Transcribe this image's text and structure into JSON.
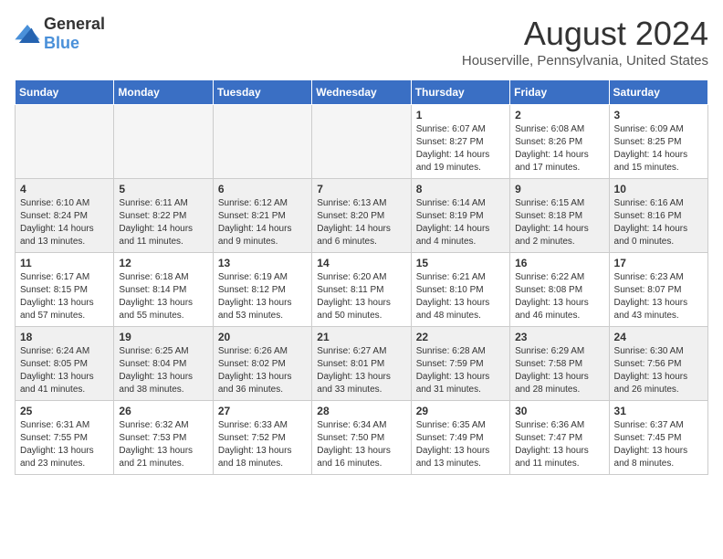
{
  "header": {
    "logo_general": "General",
    "logo_blue": "Blue",
    "month_title": "August 2024",
    "location": "Houserville, Pennsylvania, United States"
  },
  "weekdays": [
    "Sunday",
    "Monday",
    "Tuesday",
    "Wednesday",
    "Thursday",
    "Friday",
    "Saturday"
  ],
  "weeks": [
    [
      {
        "day": "",
        "info": ""
      },
      {
        "day": "",
        "info": ""
      },
      {
        "day": "",
        "info": ""
      },
      {
        "day": "",
        "info": ""
      },
      {
        "day": "1",
        "info": "Sunrise: 6:07 AM\nSunset: 8:27 PM\nDaylight: 14 hours\nand 19 minutes."
      },
      {
        "day": "2",
        "info": "Sunrise: 6:08 AM\nSunset: 8:26 PM\nDaylight: 14 hours\nand 17 minutes."
      },
      {
        "day": "3",
        "info": "Sunrise: 6:09 AM\nSunset: 8:25 PM\nDaylight: 14 hours\nand 15 minutes."
      }
    ],
    [
      {
        "day": "4",
        "info": "Sunrise: 6:10 AM\nSunset: 8:24 PM\nDaylight: 14 hours\nand 13 minutes."
      },
      {
        "day": "5",
        "info": "Sunrise: 6:11 AM\nSunset: 8:22 PM\nDaylight: 14 hours\nand 11 minutes."
      },
      {
        "day": "6",
        "info": "Sunrise: 6:12 AM\nSunset: 8:21 PM\nDaylight: 14 hours\nand 9 minutes."
      },
      {
        "day": "7",
        "info": "Sunrise: 6:13 AM\nSunset: 8:20 PM\nDaylight: 14 hours\nand 6 minutes."
      },
      {
        "day": "8",
        "info": "Sunrise: 6:14 AM\nSunset: 8:19 PM\nDaylight: 14 hours\nand 4 minutes."
      },
      {
        "day": "9",
        "info": "Sunrise: 6:15 AM\nSunset: 8:18 PM\nDaylight: 14 hours\nand 2 minutes."
      },
      {
        "day": "10",
        "info": "Sunrise: 6:16 AM\nSunset: 8:16 PM\nDaylight: 14 hours\nand 0 minutes."
      }
    ],
    [
      {
        "day": "11",
        "info": "Sunrise: 6:17 AM\nSunset: 8:15 PM\nDaylight: 13 hours\nand 57 minutes."
      },
      {
        "day": "12",
        "info": "Sunrise: 6:18 AM\nSunset: 8:14 PM\nDaylight: 13 hours\nand 55 minutes."
      },
      {
        "day": "13",
        "info": "Sunrise: 6:19 AM\nSunset: 8:12 PM\nDaylight: 13 hours\nand 53 minutes."
      },
      {
        "day": "14",
        "info": "Sunrise: 6:20 AM\nSunset: 8:11 PM\nDaylight: 13 hours\nand 50 minutes."
      },
      {
        "day": "15",
        "info": "Sunrise: 6:21 AM\nSunset: 8:10 PM\nDaylight: 13 hours\nand 48 minutes."
      },
      {
        "day": "16",
        "info": "Sunrise: 6:22 AM\nSunset: 8:08 PM\nDaylight: 13 hours\nand 46 minutes."
      },
      {
        "day": "17",
        "info": "Sunrise: 6:23 AM\nSunset: 8:07 PM\nDaylight: 13 hours\nand 43 minutes."
      }
    ],
    [
      {
        "day": "18",
        "info": "Sunrise: 6:24 AM\nSunset: 8:05 PM\nDaylight: 13 hours\nand 41 minutes."
      },
      {
        "day": "19",
        "info": "Sunrise: 6:25 AM\nSunset: 8:04 PM\nDaylight: 13 hours\nand 38 minutes."
      },
      {
        "day": "20",
        "info": "Sunrise: 6:26 AM\nSunset: 8:02 PM\nDaylight: 13 hours\nand 36 minutes."
      },
      {
        "day": "21",
        "info": "Sunrise: 6:27 AM\nSunset: 8:01 PM\nDaylight: 13 hours\nand 33 minutes."
      },
      {
        "day": "22",
        "info": "Sunrise: 6:28 AM\nSunset: 7:59 PM\nDaylight: 13 hours\nand 31 minutes."
      },
      {
        "day": "23",
        "info": "Sunrise: 6:29 AM\nSunset: 7:58 PM\nDaylight: 13 hours\nand 28 minutes."
      },
      {
        "day": "24",
        "info": "Sunrise: 6:30 AM\nSunset: 7:56 PM\nDaylight: 13 hours\nand 26 minutes."
      }
    ],
    [
      {
        "day": "25",
        "info": "Sunrise: 6:31 AM\nSunset: 7:55 PM\nDaylight: 13 hours\nand 23 minutes."
      },
      {
        "day": "26",
        "info": "Sunrise: 6:32 AM\nSunset: 7:53 PM\nDaylight: 13 hours\nand 21 minutes."
      },
      {
        "day": "27",
        "info": "Sunrise: 6:33 AM\nSunset: 7:52 PM\nDaylight: 13 hours\nand 18 minutes."
      },
      {
        "day": "28",
        "info": "Sunrise: 6:34 AM\nSunset: 7:50 PM\nDaylight: 13 hours\nand 16 minutes."
      },
      {
        "day": "29",
        "info": "Sunrise: 6:35 AM\nSunset: 7:49 PM\nDaylight: 13 hours\nand 13 minutes."
      },
      {
        "day": "30",
        "info": "Sunrise: 6:36 AM\nSunset: 7:47 PM\nDaylight: 13 hours\nand 11 minutes."
      },
      {
        "day": "31",
        "info": "Sunrise: 6:37 AM\nSunset: 7:45 PM\nDaylight: 13 hours\nand 8 minutes."
      }
    ]
  ]
}
